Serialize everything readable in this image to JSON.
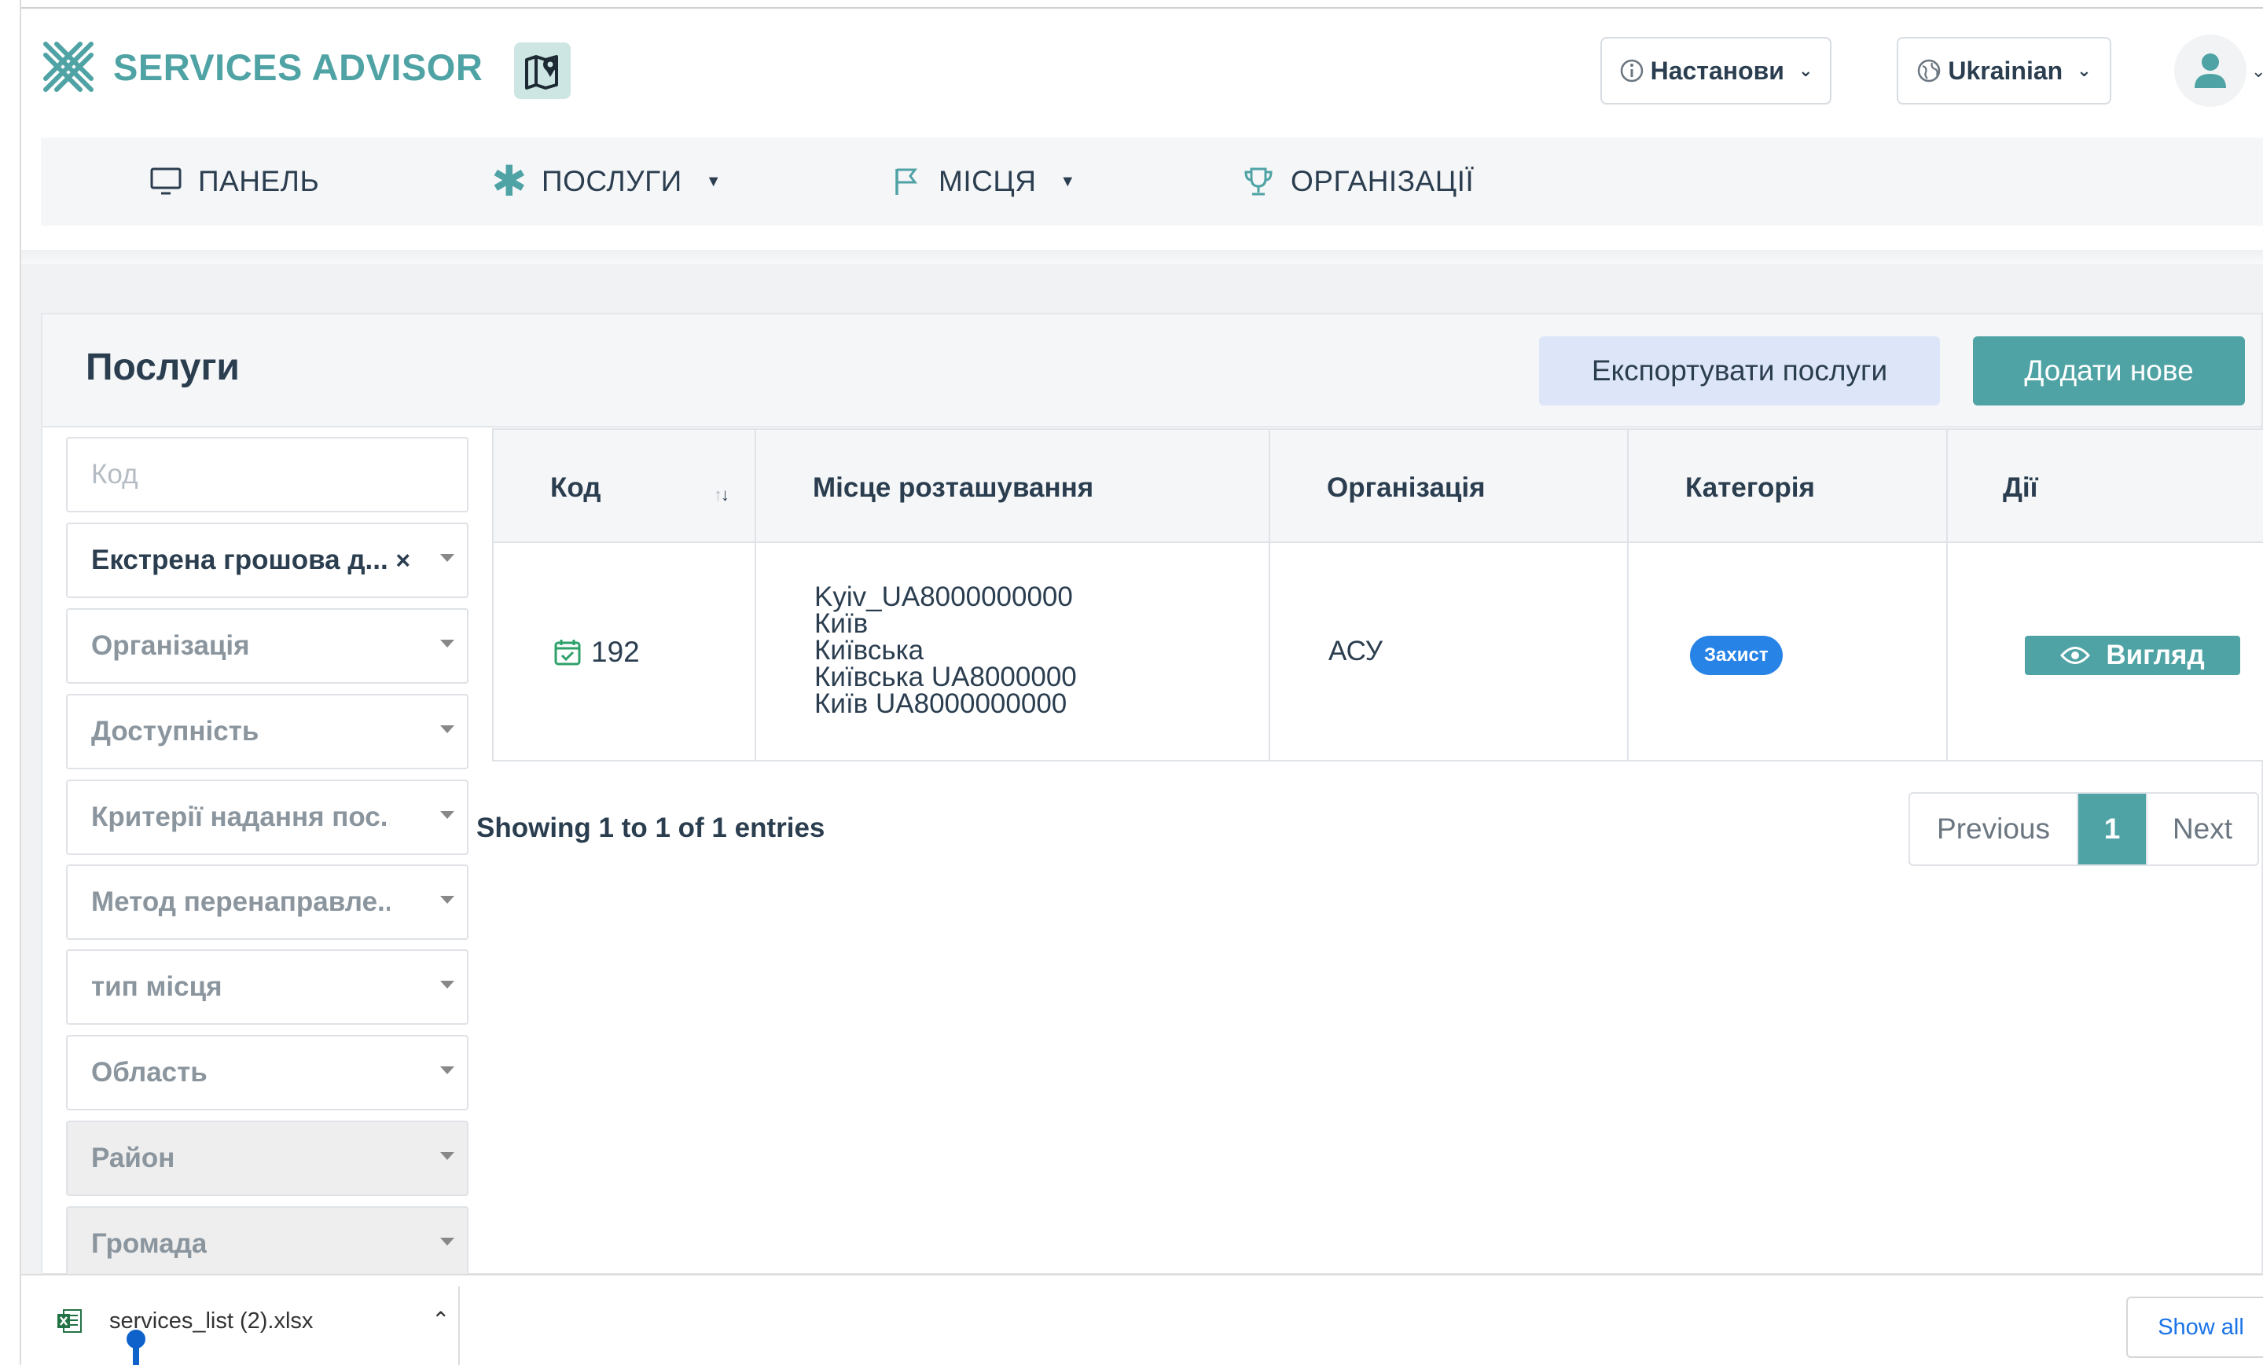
{
  "header": {
    "brand": "SERVICES ADVISOR",
    "settings_label": "Настанови",
    "language_label": "Ukrainian"
  },
  "nav": {
    "panel": "ПАНЕЛЬ",
    "services": "ПОСЛУГИ",
    "places": "МІСЦЯ",
    "organizations": "ОРГАНІЗАЦІЇ"
  },
  "page": {
    "title": "Послуги",
    "export_label": "Експортувати послуги",
    "add_label": "Додати нове"
  },
  "filters": {
    "code_placeholder": "Код",
    "category_selected": "Екстрена грошова д...",
    "clear_symbol": "×",
    "organization": "Організація",
    "accessibility": "Доступність",
    "criteria": "Критерії надання пос...",
    "referral": "Метод перенаправле...",
    "place_type": "тип місця",
    "region": "Область",
    "district": "Район",
    "community": "Громада"
  },
  "table": {
    "columns": [
      "Код",
      "Місце розташування",
      "Організація",
      "Категорія",
      "Дії"
    ],
    "rows": [
      {
        "code": "192",
        "location": [
          "Kyiv_UA8000000000",
          "Київ",
          "Київська",
          "Київська UA8000000",
          "Київ UA8000000000"
        ],
        "organization": "АСУ",
        "category": "Захист",
        "action": "Вигляд"
      }
    ]
  },
  "pagination": {
    "info": "Showing 1 to 1 of 1 entries",
    "previous": "Previous",
    "current": "1",
    "next": "Next"
  },
  "download_bar": {
    "file_name": "services_list (2).xlsx",
    "show_all": "Show all"
  },
  "colors": {
    "brand": "#4fa3a5",
    "badge": "#2783e6",
    "export_bg": "#dde6f9"
  }
}
